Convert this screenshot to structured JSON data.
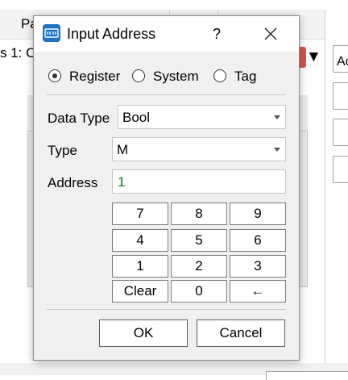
{
  "background": {
    "column_header_partial": "Pa",
    "row_text_partial": "s 1: C",
    "right_button_partial": "Ac",
    "dropdown_arrow_glyph": "▼"
  },
  "dialog": {
    "title": "Input Address",
    "help_label": "?",
    "radio_options": [
      {
        "label": "Register",
        "selected": true
      },
      {
        "label": "System",
        "selected": false
      },
      {
        "label": "Tag",
        "selected": false
      }
    ],
    "data_type": {
      "label": "Data Type",
      "value": "Bool"
    },
    "type": {
      "label": "Type",
      "value": "M"
    },
    "address": {
      "label": "Address",
      "value": "1"
    },
    "keypad": {
      "row1": [
        "7",
        "8",
        "9"
      ],
      "row2": [
        "4",
        "5",
        "6"
      ],
      "row3": [
        "1",
        "2",
        "3"
      ],
      "row4": [
        "Clear",
        "0",
        "←"
      ]
    },
    "ok_label": "OK",
    "cancel_label": "Cancel"
  },
  "colors": {
    "app_icon": "#1f6fc4",
    "address_text": "#0a7a1c",
    "bg_dropdown_accent": "#d9534f"
  }
}
